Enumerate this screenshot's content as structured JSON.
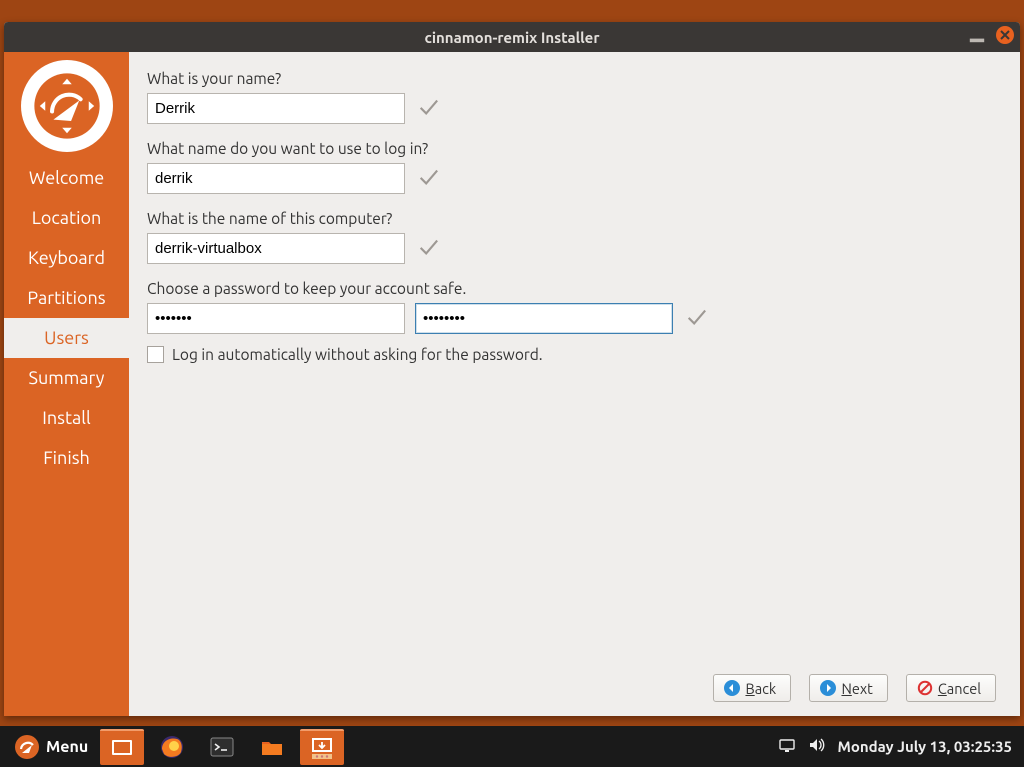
{
  "window": {
    "title": "cinnamon-remix Installer"
  },
  "sidebar": {
    "steps": [
      {
        "label": "Welcome",
        "name": "sidebar-step-welcome"
      },
      {
        "label": "Location",
        "name": "sidebar-step-location"
      },
      {
        "label": "Keyboard",
        "name": "sidebar-step-keyboard"
      },
      {
        "label": "Partitions",
        "name": "sidebar-step-partitions"
      },
      {
        "label": "Users",
        "name": "sidebar-step-users",
        "active": true
      },
      {
        "label": "Summary",
        "name": "sidebar-step-summary"
      },
      {
        "label": "Install",
        "name": "sidebar-step-install"
      },
      {
        "label": "Finish",
        "name": "sidebar-step-finish"
      }
    ]
  },
  "form": {
    "name_q": "What is your name?",
    "name_val": "Derrik",
    "login_q": "What name do you want to use to log in?",
    "login_val": "derrik",
    "host_q": "What is the name of this computer?",
    "host_val": "derrik-virtualbox",
    "pw_q": "Choose a password to keep your account safe.",
    "pw_val": "•••••••",
    "pw_confirm_val": "••••••••",
    "autologin_label": "Log in automatically without asking for the password."
  },
  "buttons": {
    "back": "Back",
    "next": "Next",
    "cancel": "Cancel"
  },
  "taskbar": {
    "menu_label": "Menu",
    "clock": "Monday July 13, 03:25:35"
  }
}
